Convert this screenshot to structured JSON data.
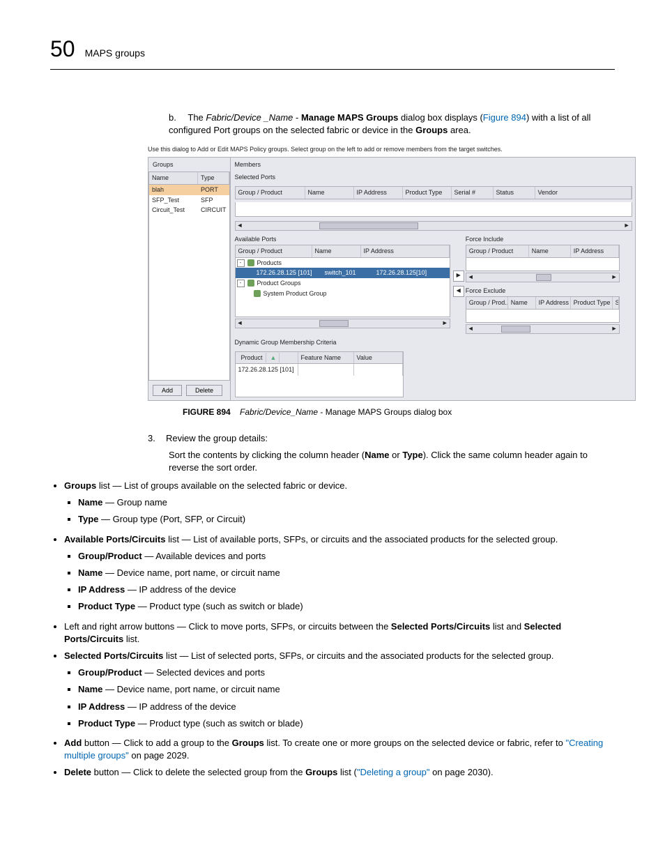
{
  "header": {
    "chapter_number": "50",
    "chapter_title": "MAPS groups"
  },
  "intro": {
    "marker": "b.",
    "t1": "The ",
    "italic1": "Fabric/Device _Name",
    "dash": " - ",
    "bold1": "Manage MAPS Groups",
    "t2": " dialog box displays (",
    "link1": "Figure 894",
    "t3": ") with a list of all configured Port groups on the selected fabric or device in the ",
    "bold2": "Groups",
    "t4": " area."
  },
  "dialog": {
    "instruction": "Use this dialog to Add or Edit MAPS Policy groups. Select group on the left to add or remove members from the target switches.",
    "groups": {
      "title": "Groups",
      "cols": {
        "name": "Name",
        "type": "Type"
      },
      "rows": [
        {
          "name": "blah",
          "type": "PORT",
          "selected": true
        },
        {
          "name": "SFP_Test",
          "type": "SFP"
        },
        {
          "name": "Circuit_Test",
          "type": "CIRCUIT"
        }
      ]
    },
    "members": {
      "title": "Members",
      "selected_ports": "Selected Ports",
      "cols": {
        "gp": "Group / Product",
        "name": "Name",
        "ip": "IP Address",
        "ptype": "Product Type",
        "serial": "Serial #",
        "status": "Status",
        "vendor": "Vendor"
      }
    },
    "available": {
      "title": "Available Ports",
      "cols": {
        "gp": "Group / Product",
        "name": "Name",
        "ip": "IP Address"
      },
      "row_products": "Products",
      "row_ip_name": "172.26.28.125 [101]",
      "row_switch": "switch_101",
      "row_switch_ip": "172.26.28.125[10]",
      "row_pg": "Product Groups",
      "row_spg": "System Product Group"
    },
    "force_include": {
      "title": "Force Include",
      "cols": {
        "gp": "Group / Product",
        "name": "Name",
        "ip": "IP Address"
      }
    },
    "force_exclude": {
      "title": "Force Exclude",
      "cols": {
        "gp": "Group / Prod...",
        "name": "Name",
        "ip": "IP Address",
        "ptype": "Product Type",
        "serial": "Serial #"
      }
    },
    "dynamic": {
      "title": "Dynamic Group Membership Criteria",
      "cols": {
        "product": "Product",
        "fname": "Feature Name",
        "value": "Value"
      },
      "row_product": "172.26.28.125 [101]"
    },
    "buttons": {
      "add": "Add",
      "delete": "Delete"
    }
  },
  "figure": {
    "label": "FIGURE 894",
    "italic": "Fabric/Device_Name",
    "rest": " - Manage MAPS Groups dialog box"
  },
  "step3": {
    "marker": "3.",
    "text": "Review the group details:"
  },
  "sort": {
    "p1": "Sort the contents by clicking the column header (",
    "b1": "Name",
    "or": " or ",
    "b2": "Type",
    "p2": "). Click the same column header again to reverse the sort order."
  },
  "bullets": {
    "groups": {
      "b": "Groups",
      "t": " list — List of groups available on the selected fabric or device."
    },
    "groups_name": {
      "b": "Name",
      "t": " — Group name"
    },
    "groups_type": {
      "b": "Type",
      "t": " — Group type (Port, SFP, or Circuit)"
    },
    "avail": {
      "b": "Available Ports/Circuits",
      "t": " list — List of available ports, SFPs, or circuits and the associated products for the selected group."
    },
    "avail_gp": {
      "b": "Group/Product",
      "t": " — Available devices and ports"
    },
    "avail_name": {
      "b": "Name",
      "t": " — Device name, port name, or circuit name"
    },
    "avail_ip": {
      "b": "IP Address",
      "t": " — IP address of the device"
    },
    "avail_pt": {
      "b": "Product Type",
      "t": " — Product type (such as switch or blade)"
    },
    "arrows": {
      "t1": "Left and right arrow buttons — Click to move ports, SFPs, or circuits between the ",
      "b1": "Selected Ports/Circuits",
      "t2": " list and ",
      "b2": "Selected Ports/Circuits",
      "t3": " list."
    },
    "selpc": {
      "b": "Selected Ports/Circuits",
      "t": " list — List of selected ports, SFPs, or circuits and the associated products for the selected group."
    },
    "selpc_gp": {
      "b": "Group/Product",
      "t": " — Selected devices and ports"
    },
    "selpc_name": {
      "b": "Name",
      "t": " — Device name, port name, or circuit name"
    },
    "selpc_ip": {
      "b": "IP Address",
      "t": " — IP address of the device"
    },
    "selpc_pt": {
      "b": "Product Type",
      "t": " — Product type (such as switch or blade)"
    },
    "addbtn": {
      "b": "Add",
      "t1": " button — Click to add a group to the ",
      "b2": "Groups",
      "t2": " list. To create one or more groups on the selected device or fabric, refer to ",
      "link": "\"Creating multiple groups\"",
      "t3": " on page 2029."
    },
    "delbtn": {
      "b": "Delete",
      "t1": " button — Click to delete the selected group from the ",
      "b2": "Groups",
      "t2": " list (",
      "link": "\"Deleting a group\"",
      "t3": " on page 2030)."
    }
  }
}
